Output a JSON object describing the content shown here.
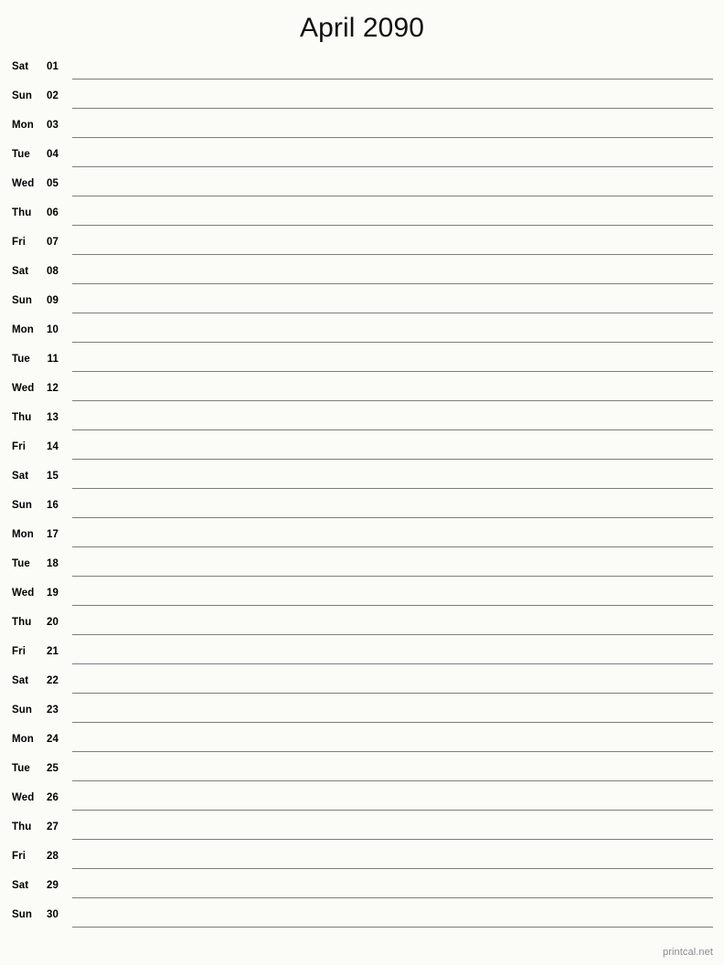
{
  "document": {
    "title": "April 2090",
    "month": "April",
    "year": "2090",
    "type": "printable-monthly-notes-calendar",
    "background_color": "#fbfcf8",
    "line_color": "#7d7d7d",
    "text_color": "#000000"
  },
  "footer": {
    "label": "printcal.net",
    "color": "#8a8a8a"
  },
  "days": [
    {
      "weekday": "Sat",
      "number": "01"
    },
    {
      "weekday": "Sun",
      "number": "02"
    },
    {
      "weekday": "Mon",
      "number": "03"
    },
    {
      "weekday": "Tue",
      "number": "04"
    },
    {
      "weekday": "Wed",
      "number": "05"
    },
    {
      "weekday": "Thu",
      "number": "06"
    },
    {
      "weekday": "Fri",
      "number": "07"
    },
    {
      "weekday": "Sat",
      "number": "08"
    },
    {
      "weekday": "Sun",
      "number": "09"
    },
    {
      "weekday": "Mon",
      "number": "10"
    },
    {
      "weekday": "Tue",
      "number": "11"
    },
    {
      "weekday": "Wed",
      "number": "12"
    },
    {
      "weekday": "Thu",
      "number": "13"
    },
    {
      "weekday": "Fri",
      "number": "14"
    },
    {
      "weekday": "Sat",
      "number": "15"
    },
    {
      "weekday": "Sun",
      "number": "16"
    },
    {
      "weekday": "Mon",
      "number": "17"
    },
    {
      "weekday": "Tue",
      "number": "18"
    },
    {
      "weekday": "Wed",
      "number": "19"
    },
    {
      "weekday": "Thu",
      "number": "20"
    },
    {
      "weekday": "Fri",
      "number": "21"
    },
    {
      "weekday": "Sat",
      "number": "22"
    },
    {
      "weekday": "Sun",
      "number": "23"
    },
    {
      "weekday": "Mon",
      "number": "24"
    },
    {
      "weekday": "Tue",
      "number": "25"
    },
    {
      "weekday": "Wed",
      "number": "26"
    },
    {
      "weekday": "Thu",
      "number": "27"
    },
    {
      "weekday": "Fri",
      "number": "28"
    },
    {
      "weekday": "Sat",
      "number": "29"
    },
    {
      "weekday": "Sun",
      "number": "30"
    }
  ]
}
